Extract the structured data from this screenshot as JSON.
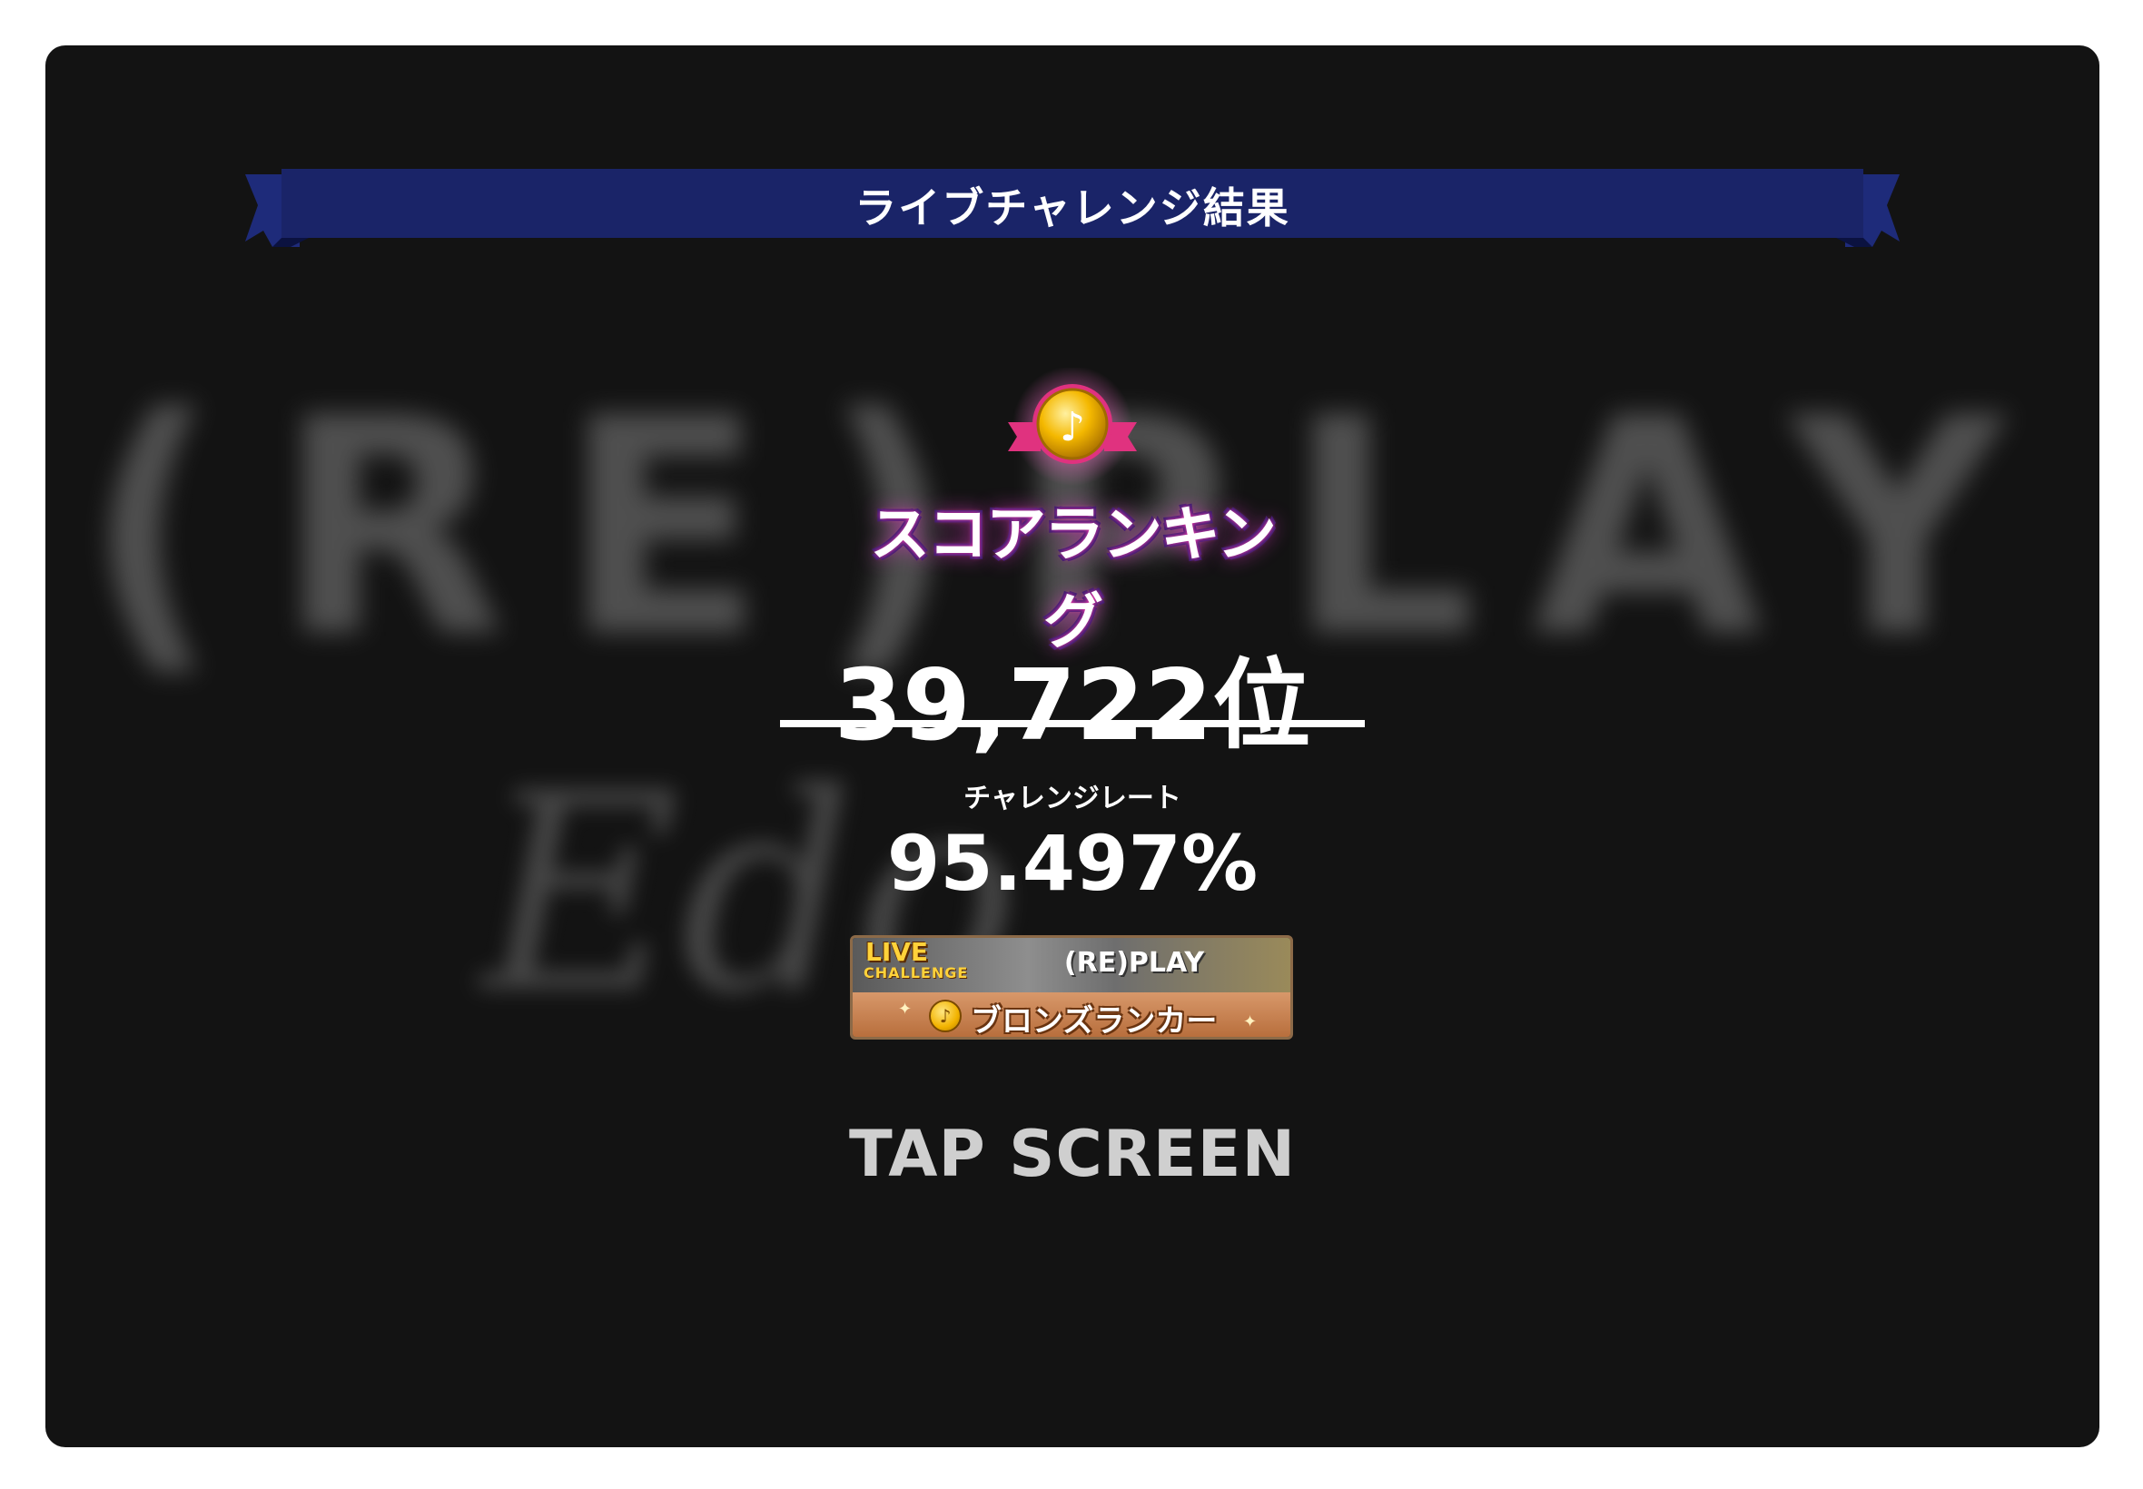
{
  "banner": {
    "title": "ライブチャレンジ結果",
    "color": "#1a2468"
  },
  "background": {
    "song_title_blurred": "(RE)PLAY",
    "signature_blurred": "Edo"
  },
  "emblem": {
    "label": "スコアランキング",
    "icon": "gold-note-medal-icon"
  },
  "result": {
    "rank": "39,722位",
    "rate_label": "チャレンジレート",
    "rate_value": "95.497%"
  },
  "badge": {
    "live_text": "LIVE",
    "challenge_text": "CHALLENGE",
    "song": "(RE)PLAY",
    "tier": "ブロンズランカー",
    "icon": "bronze-coin-icon"
  },
  "prompt": {
    "text": "TAP SCREEN"
  }
}
